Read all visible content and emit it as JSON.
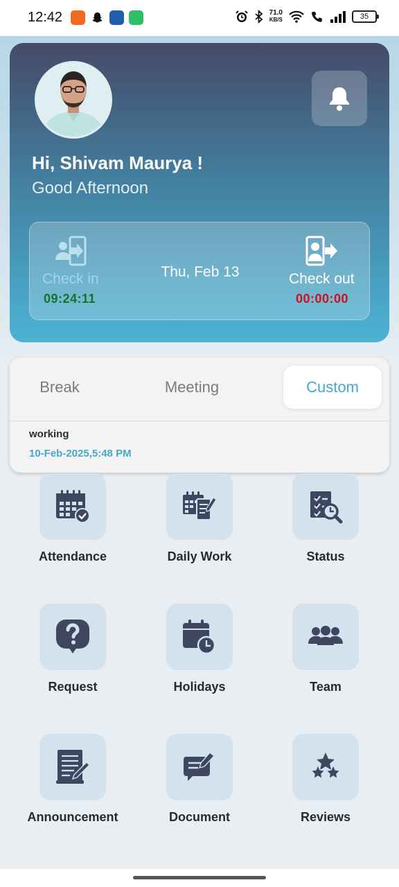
{
  "status_bar": {
    "time": "12:42",
    "net_speed_value": "71.0",
    "net_speed_unit": "KB/S",
    "battery": "35",
    "app_icons": [
      "orange-app-icon",
      "snapchat-icon",
      "blue-app-icon",
      "green-bag-icon"
    ]
  },
  "profile": {
    "greeting_name": "Hi, Shivam Maurya !",
    "greeting_time": "Good Afternoon"
  },
  "attendance": {
    "check_in_label": "Check in",
    "check_in_time": "09:24:11",
    "date": "Thu, Feb 13",
    "check_out_label": "Check out",
    "check_out_time": "00:00:00"
  },
  "tabs": {
    "items": [
      "Break",
      "Meeting",
      "Custom"
    ],
    "selected": "Custom"
  },
  "log": {
    "status": "working",
    "timestamp": "10-Feb-2025,5:48 PM"
  },
  "menu": [
    {
      "label": "Attendance",
      "icon": "calendar-check-icon"
    },
    {
      "label": "Daily Work",
      "icon": "calendar-pen-icon"
    },
    {
      "label": "Status",
      "icon": "report-search-icon"
    },
    {
      "label": "Request",
      "icon": "question-bubble-icon"
    },
    {
      "label": "Holidays",
      "icon": "calendar-clock-icon"
    },
    {
      "label": "Team",
      "icon": "team-icon"
    },
    {
      "label": "Announcement",
      "icon": "document-pen-icon"
    },
    {
      "label": "Document",
      "icon": "message-edit-icon"
    },
    {
      "label": "Reviews",
      "icon": "stars-icon"
    }
  ],
  "colors": {
    "accent": "#44a9c8",
    "icon": "#3e4660",
    "check_in_time": "#1d6f2b",
    "check_out_time": "#d0101b"
  }
}
